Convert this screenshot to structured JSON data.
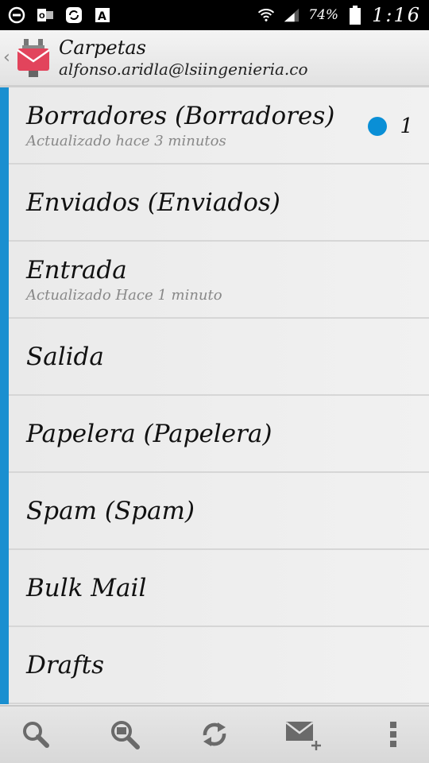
{
  "status_bar": {
    "battery": "74%",
    "time": "1:16",
    "icons": [
      "minus-circle-icon",
      "outlook-icon",
      "sync-app-icon",
      "font-app-icon",
      "wifi-icon",
      "signal-icon",
      "battery-icon"
    ]
  },
  "action_bar": {
    "title": "Carpetas",
    "account": "alfonso.aridla@lsiingenieria.co",
    "icons": [
      "back-chevron-icon",
      "k9-mail-icon"
    ]
  },
  "folders": [
    {
      "name": "Borradores (Borradores)",
      "status": "Actualizado hace 3 minutos",
      "unread": "1"
    },
    {
      "name": "Enviados (Enviados)",
      "status": "",
      "unread": ""
    },
    {
      "name": "Entrada",
      "status": "Actualizado Hace 1 minuto",
      "unread": ""
    },
    {
      "name": "Salida",
      "status": "",
      "unread": ""
    },
    {
      "name": "Papelera (Papelera)",
      "status": "",
      "unread": ""
    },
    {
      "name": "Spam (Spam)",
      "status": "",
      "unread": ""
    },
    {
      "name": "Bulk Mail",
      "status": "",
      "unread": ""
    },
    {
      "name": "Drafts",
      "status": "",
      "unread": ""
    }
  ],
  "bottom_bar": {
    "icons": [
      "search-icon",
      "search-messages-icon",
      "refresh-icon",
      "compose-icon",
      "overflow-menu-icon"
    ]
  },
  "colors": {
    "accent": "#1a8fd0",
    "unread_dot": "#0a8fd6",
    "app_icon": "#e2445c"
  }
}
